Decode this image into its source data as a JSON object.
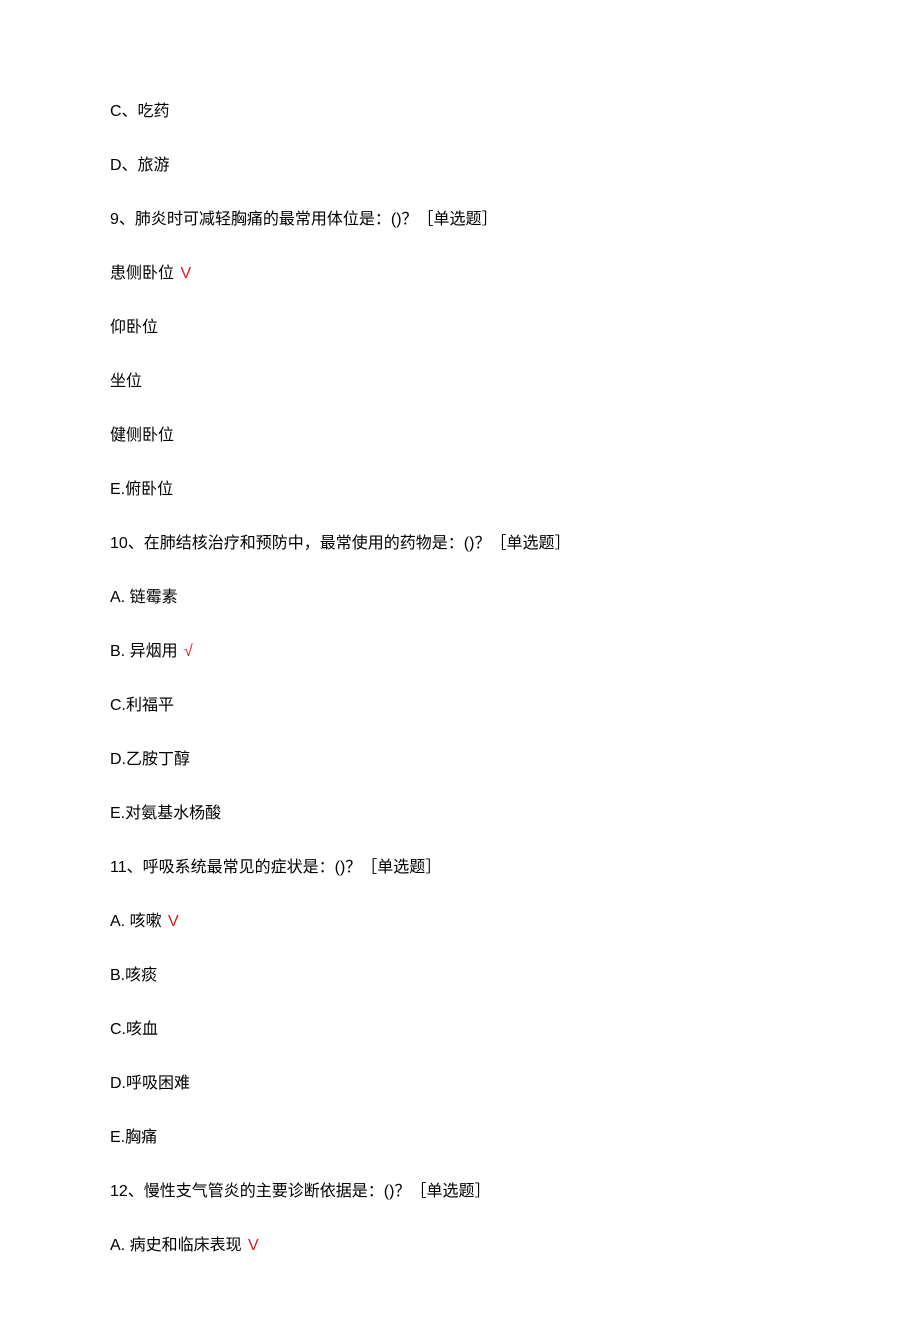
{
  "lines": [
    {
      "text": "C、吃药",
      "checked": false
    },
    {
      "text": "D、旅游",
      "checked": false
    },
    {
      "text": "9、肺炎时可减轻胸痛的最常用体位是：()？［单选题］",
      "checked": false
    },
    {
      "text": "患侧卧位",
      "checked": true
    },
    {
      "text": "仰卧位",
      "checked": false
    },
    {
      "text": "坐位",
      "checked": false
    },
    {
      "text": "健侧卧位",
      "checked": false
    },
    {
      "text": "E.俯卧位",
      "checked": false
    },
    {
      "text": "10、在肺结核治疗和预防中，最常使用的药物是：()？［单选题］",
      "checked": false
    },
    {
      "text": "A. 链霉素",
      "checked": false
    },
    {
      "text": "B. 异烟用",
      "checked": true,
      "checkSymbol": "√"
    },
    {
      "text": "C.利福平",
      "checked": false
    },
    {
      "text": "D.乙胺丁醇",
      "checked": false
    },
    {
      "text": "E.对氨基水杨酸",
      "checked": false
    },
    {
      "text": "11、呼吸系统最常见的症状是：()？［单选题］",
      "checked": false
    },
    {
      "text": "A. 咳嗽",
      "checked": true
    },
    {
      "text": "B.咳痰",
      "checked": false
    },
    {
      "text": "C.咳血",
      "checked": false
    },
    {
      "text": "D.呼吸困难",
      "checked": false
    },
    {
      "text": "E.胸痛",
      "checked": false
    },
    {
      "text": "12、慢性支气管炎的主要诊断依据是：()？［单选题］",
      "checked": false
    },
    {
      "text": "A. 病史和临床表现",
      "checked": true
    }
  ],
  "defaultCheck": "V"
}
